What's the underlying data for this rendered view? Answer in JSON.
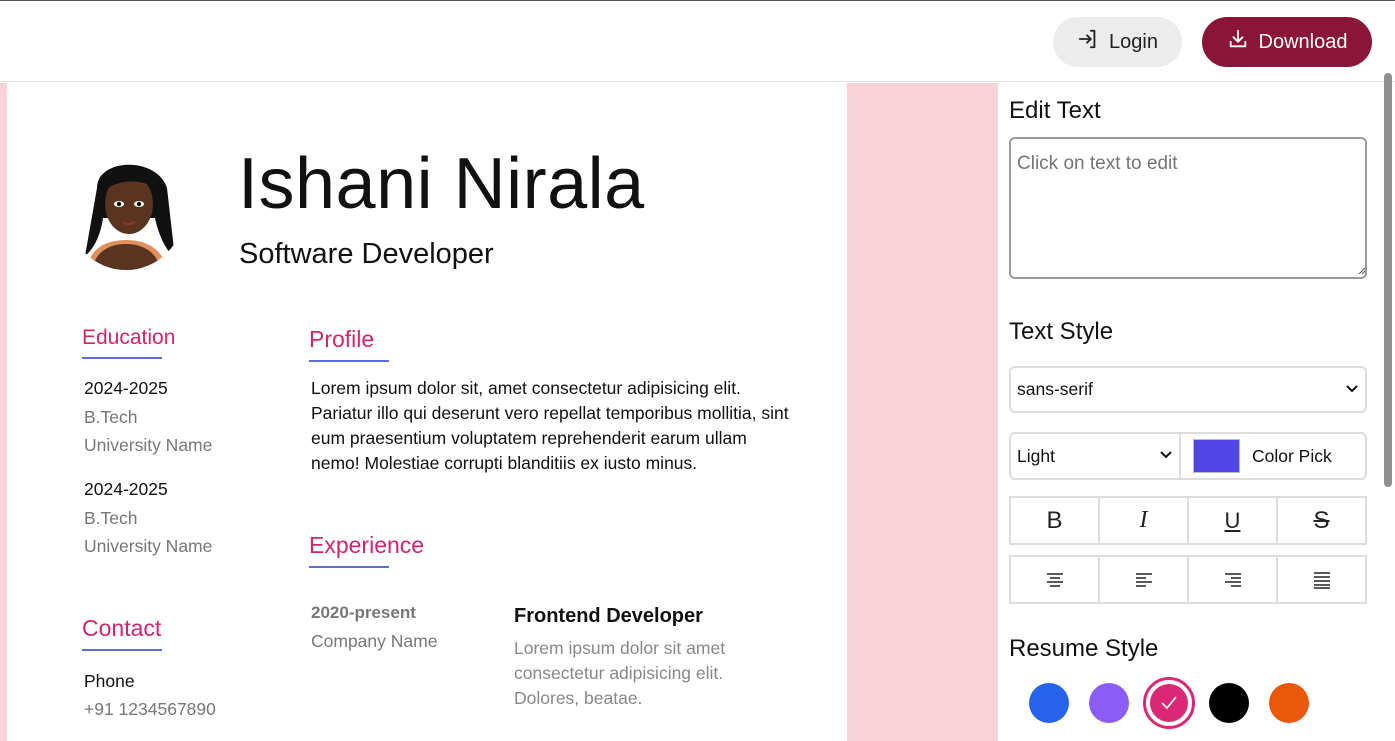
{
  "header": {
    "login_label": "Login",
    "download_label": "Download",
    "login_icon": "login-icon",
    "download_icon": "download-icon",
    "download_color": "#8a1538"
  },
  "resume": {
    "name": "Ishani Nirala",
    "role": "Software Developer",
    "education": {
      "title": "Education",
      "entries": [
        {
          "years": "2024-2025",
          "degree": "B.Tech",
          "school": "University Name"
        },
        {
          "years": "2024-2025",
          "degree": "B.Tech",
          "school": "University Name"
        }
      ]
    },
    "profile": {
      "title": "Profile",
      "text": "Lorem ipsum dolor sit, amet consectetur adipisicing elit. Pariatur illo qui deserunt vero repellat temporibus mollitia, sint eum praesentium voluptatem reprehenderit earum ullam nemo! Molestiae corrupti blanditiis ex iusto minus."
    },
    "experience": {
      "title": "Experience",
      "period": "2020-present",
      "company": "Company Name",
      "job_title": "Frontend Developer",
      "description": "Lorem ipsum dolor sit amet consectetur adipisicing elit. Dolores, beatae."
    },
    "contact": {
      "title": "Contact",
      "label": "Phone",
      "value": "+91 1234567890"
    },
    "accent_color": "#d0256f",
    "underline_color": "#5b6ed8",
    "background_color": "#f9d3d9"
  },
  "panel": {
    "edit_text_heading": "Edit Text",
    "edit_text_placeholder": "Click on text to edit",
    "text_style_heading": "Text Style",
    "font_value": "sans-serif",
    "weight_value": "Light",
    "color_pick_label": "Color Pick",
    "color_value": "#4f46e5",
    "format_buttons": [
      "B",
      "I",
      "U",
      "S"
    ],
    "align_buttons": [
      "align-center-icon",
      "align-left-icon",
      "align-right-icon",
      "align-justify-icon"
    ],
    "resume_style_heading": "Resume Style",
    "style_colors": [
      "#2563eb",
      "#8b5cf6",
      "#db2777",
      "#000000",
      "#ea580c"
    ],
    "selected_style_index": 2
  }
}
